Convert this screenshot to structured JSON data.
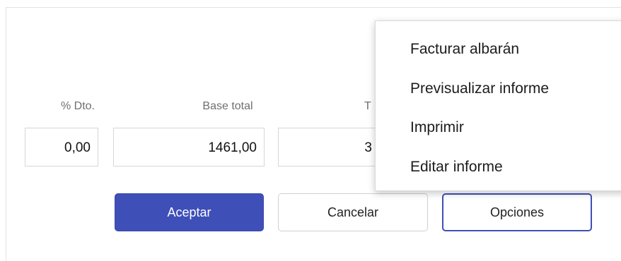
{
  "columns": {
    "dto_label": "% Dto.",
    "base_label": "Base total",
    "partial_label": "T"
  },
  "fields": {
    "dto_value": "0,00",
    "base_value": "1461,00",
    "partial_value": "3"
  },
  "buttons": {
    "accept": "Aceptar",
    "cancel": "Cancelar",
    "options": "Opciones"
  },
  "menu": {
    "items": [
      {
        "label": "Facturar albarán"
      },
      {
        "label": "Previsualizar informe"
      },
      {
        "label": "Imprimir"
      },
      {
        "label": "Editar informe"
      }
    ]
  },
  "colors": {
    "primary": "#3f4fb8",
    "label": "#6f6f6f"
  }
}
